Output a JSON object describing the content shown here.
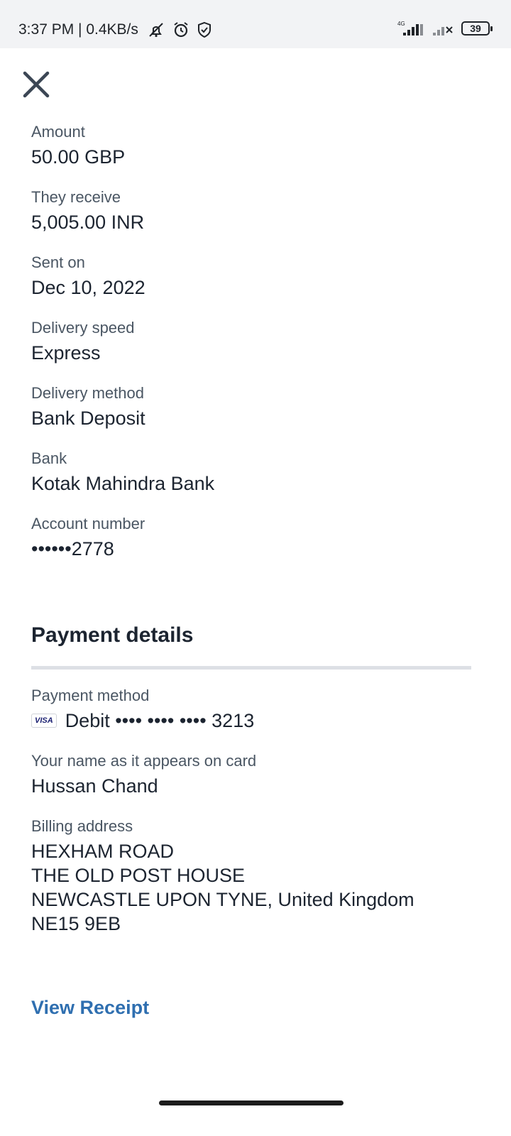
{
  "status_bar": {
    "time": "3:37 PM | 0.4KB/s",
    "network": "4G",
    "battery": "39"
  },
  "transfer": {
    "amount_label": "Amount",
    "amount_value": "50.00 GBP",
    "receive_label": "They receive",
    "receive_value": "5,005.00 INR",
    "sent_label": "Sent on",
    "sent_value": "Dec 10, 2022",
    "speed_label": "Delivery speed",
    "speed_value": "Express",
    "method_label": "Delivery method",
    "method_value": "Bank Deposit",
    "bank_label": "Bank",
    "bank_value": "Kotak Mahindra Bank",
    "account_label": "Account number",
    "account_value": "••••••2778"
  },
  "payment": {
    "title": "Payment details",
    "method_label": "Payment method",
    "card_brand": "VISA",
    "card_value": "Debit •••• •••• •••• 3213",
    "name_label": "Your name as it appears on card",
    "name_value": "Hussan Chand",
    "billing_label": "Billing address",
    "billing_lines": [
      "HEXHAM ROAD",
      "THE OLD POST HOUSE",
      "NEWCASTLE UPON TYNE, United Kingdom",
      "NE15 9EB"
    ]
  },
  "actions": {
    "view_receipt": "View Receipt"
  }
}
